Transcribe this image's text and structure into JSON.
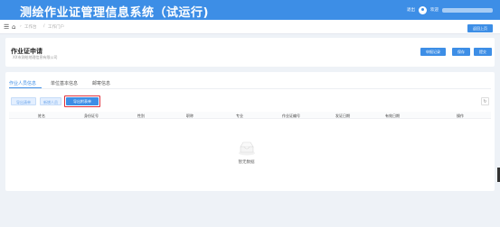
{
  "header": {
    "app_title": "测绘作业证管理信息系统（试运行)",
    "logout_label": "退出",
    "user_label": "欢迎"
  },
  "navbar": {
    "breadcrumb": [
      "工作台",
      "工作门户"
    ],
    "back_label": "返回上页"
  },
  "form": {
    "title": "作业证申请",
    "subtitle": "XX市测绘地理信息有限公司",
    "actions": [
      "申报记录",
      "保存",
      "提交"
    ]
  },
  "tabs": [
    {
      "label": "作业人员信息",
      "active": true
    },
    {
      "label": "单位基本信息",
      "active": false
    },
    {
      "label": "邮寄信息",
      "active": false
    }
  ],
  "toolbar": {
    "buttons": [
      "导出清单",
      "新增人员",
      "导出附表单"
    ],
    "refresh_icon": "refresh-icon"
  },
  "table": {
    "columns": [
      "姓名",
      "身份证号",
      "性别",
      "职称",
      "专业",
      "作业证编号",
      "发证日期",
      "有效日期",
      "操作"
    ],
    "rows": [],
    "empty_text": "暂无数据"
  },
  "colors": {
    "primary": "#3d8ee6",
    "highlight": "#e0303b",
    "background": "#eef2f7"
  }
}
